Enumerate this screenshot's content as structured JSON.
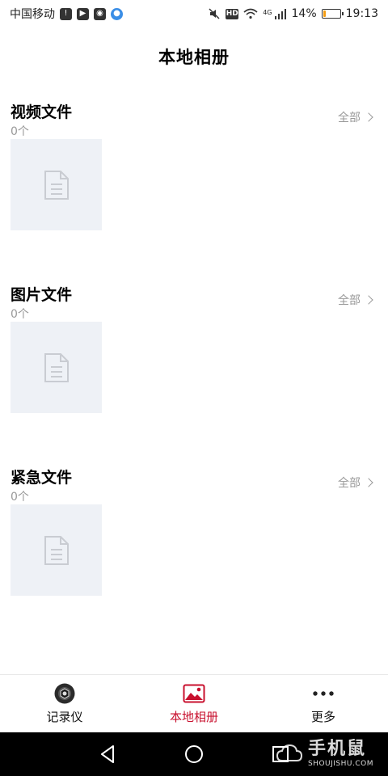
{
  "status_bar": {
    "carrier": "中国移动",
    "network": "4G",
    "battery_text": "14%",
    "battery_level": 0.14,
    "time": "19:13",
    "hd_label": "HD",
    "icons": [
      "sim-icon",
      "play-store-icon",
      "wechat-icon",
      "app-icon",
      "mute-icon",
      "hd-icon",
      "wifi-icon",
      "signal-icon",
      "battery-icon"
    ]
  },
  "header": {
    "title": "本地相册"
  },
  "sections": [
    {
      "title": "视频文件",
      "count": "0个",
      "all_label": "全部"
    },
    {
      "title": "图片文件",
      "count": "0个",
      "all_label": "全部"
    },
    {
      "title": "紧急文件",
      "count": "0个",
      "all_label": "全部"
    }
  ],
  "bottom_nav": {
    "items": [
      {
        "label": "记录仪",
        "icon": "camera-lens-icon",
        "active": false
      },
      {
        "label": "本地相册",
        "icon": "photo-album-icon",
        "active": true
      },
      {
        "label": "更多",
        "icon": "more-dots-icon",
        "active": false
      }
    ]
  },
  "watermark": {
    "brand": "手机鼠",
    "url": "SHOUJISHU.COM"
  },
  "colors": {
    "accent": "#c8102e",
    "muted": "#999999",
    "thumb_bg": "#eef1f6",
    "battery": "#f39c12"
  }
}
